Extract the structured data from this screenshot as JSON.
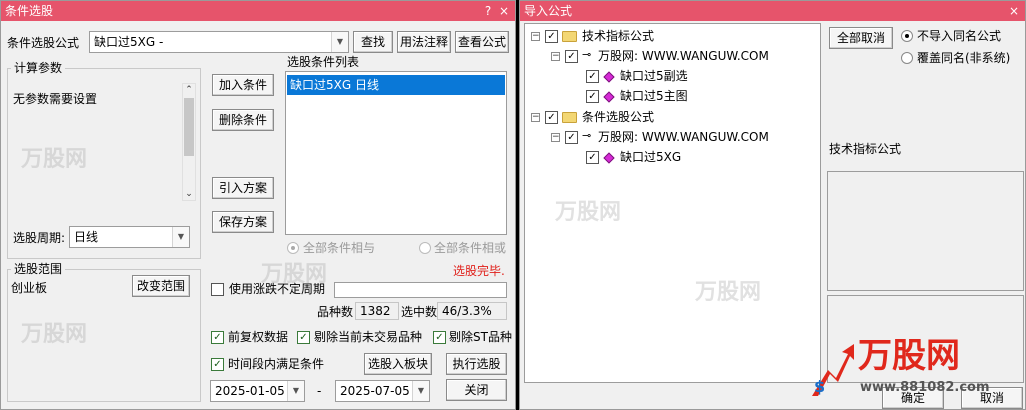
{
  "left_window": {
    "title": "条件选股",
    "title_buttons": [
      "?",
      "×"
    ],
    "formula_label": "条件选股公式",
    "formula_value": "缺口过5XG  -",
    "search_button": "查找",
    "usage_button": "用法注释",
    "view_formula_button": "查看公式",
    "calc_params_title": "计算参数",
    "no_params_text": "无参数需要设置",
    "period_label": "选股周期:",
    "period_value": "日线",
    "add_condition_button": "加入条件",
    "delete_condition_button": "删除条件",
    "import_plan_button": "引入方案",
    "save_plan_button": "保存方案",
    "condition_list_title": "选股条件列表",
    "condition_items": [
      "缺口过5XG  日线"
    ],
    "and_option": "全部条件相与",
    "or_option": "全部条件相或",
    "status_text": "选股完毕.",
    "range_title": "选股范围",
    "range_value": "创业板",
    "change_range_button": "改变范围",
    "use_irregular_period": "使用涨跌不定周期",
    "stock_count_label": "品种数",
    "stock_count_value": "1382",
    "selected_label": "选中数",
    "selected_value": "46/3.3%",
    "forward_adjust": "前复权数据",
    "exclude_untraded": "剔除当前未交易品种",
    "exclude_st": "剔除ST品种",
    "time_range_condition": "时间段内满足条件",
    "select_to_board_button": "选股入板块",
    "execute_button": "执行选股",
    "date_from": "2025-01-05",
    "date_separator": "-",
    "date_to": "2025-07-05",
    "close_button": "关闭"
  },
  "right_window": {
    "title": "导入公式",
    "close_symbol": "×",
    "tree": {
      "folder1": "技术指标公式",
      "source1": "万股网: WWW.WANGUW.COM",
      "item1": "缺口过5副选",
      "item2": "缺口过5主图",
      "folder2": "条件选股公式",
      "source2": "万股网: WWW.WANGUW.COM",
      "item3": "缺口过5XG"
    },
    "cancel_all_button": "全部取消",
    "no_import_same": "不导入同名公式",
    "overwrite_same": "覆盖同名(非系统)",
    "type_label": "技术指标公式",
    "ok_button": "确定",
    "cancel_button": "取消"
  },
  "logo": {
    "text": "万股网",
    "url_text": "www.881082.com"
  },
  "watermark_text": "万股网",
  "colors": {
    "titlebar": "#e6546b",
    "selection": "#0a78d7",
    "status_red": "#e0201a",
    "logo_red": "#e0281c",
    "logo_blue": "#1b6fc9"
  }
}
